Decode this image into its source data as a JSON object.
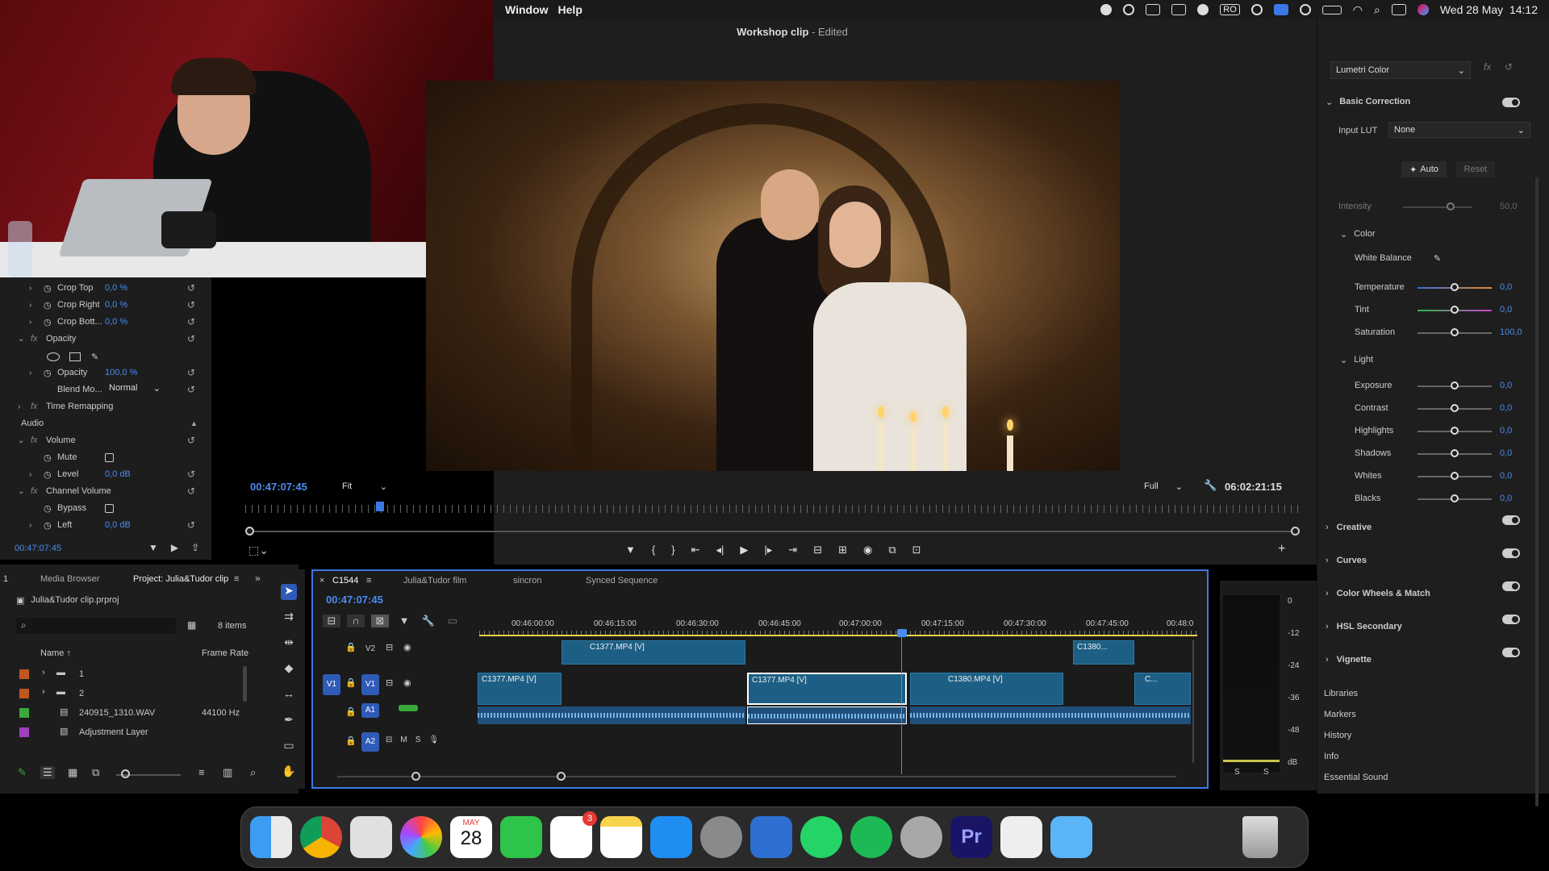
{
  "menubar": {
    "items": [
      "Window",
      "Help"
    ],
    "date_time": "Wed 28 May  14:12",
    "lang": "RO"
  },
  "monitor": {
    "title": "Workshop clip",
    "title_suffix": " - Edited",
    "timecode_left": "00:47:07:45",
    "fit": "Fit",
    "quality": "Full",
    "duration": "06:02:21:15"
  },
  "effects": {
    "rows": [
      {
        "label": "Crop Top",
        "value": "0,0 %"
      },
      {
        "label": "Crop Right",
        "value": "0,0 %"
      },
      {
        "label": "Crop Bott...",
        "value": "0,0 %"
      },
      {
        "label": "Opacity",
        "value": ""
      },
      {
        "label": "Opacity",
        "value": "100,0 %"
      },
      {
        "label": "Blend Mo...",
        "value": "Normal"
      },
      {
        "label": "Time Remapping",
        "value": ""
      },
      {
        "label": "Audio",
        "value": ""
      },
      {
        "label": "Volume",
        "value": ""
      },
      {
        "label": "Mute",
        "value": ""
      },
      {
        "label": "Level",
        "value": "0,0 dB"
      },
      {
        "label": "Channel Volume",
        "value": ""
      },
      {
        "label": "Bypass",
        "value": ""
      },
      {
        "label": "Left",
        "value": "0,0 dB"
      }
    ],
    "timecode": "00:47:07:45"
  },
  "lumetri": {
    "effect": "Lumetri Color",
    "basic": "Basic Correction",
    "input_lut_label": "Input LUT",
    "input_lut_value": "None",
    "auto": "Auto",
    "reset": "Reset",
    "intensity_label": "Intensity",
    "intensity_value": "50,0",
    "color_section": "Color",
    "white_balance": "White Balance",
    "temperature": {
      "label": "Temperature",
      "value": "0,0"
    },
    "tint": {
      "label": "Tint",
      "value": "0,0"
    },
    "saturation": {
      "label": "Saturation",
      "value": "100,0"
    },
    "light_section": "Light",
    "light": [
      {
        "label": "Exposure",
        "value": "0,0"
      },
      {
        "label": "Contrast",
        "value": "0,0"
      },
      {
        "label": "Highlights",
        "value": "0,0"
      },
      {
        "label": "Shadows",
        "value": "0,0"
      },
      {
        "label": "Whites",
        "value": "0,0"
      },
      {
        "label": "Blacks",
        "value": "0,0"
      }
    ],
    "sections": [
      "Creative",
      "Curves",
      "Color Wheels & Match",
      "HSL Secondary",
      "Vignette"
    ],
    "panels": [
      "Libraries",
      "Markers",
      "History",
      "Info",
      "Essential Sound"
    ]
  },
  "project": {
    "tab_num": "1",
    "tabs": [
      "Media Browser",
      "Project: Julia&Tudor clip"
    ],
    "file": "Julia&Tudor clip.prproj",
    "count": "8 items",
    "col_name": "Name",
    "col_rate": "Frame Rate",
    "items": [
      {
        "name": "1",
        "rate": "",
        "color": "#c0571f"
      },
      {
        "name": "2",
        "rate": "",
        "color": "#c0571f"
      },
      {
        "name": "240915_1310.WAV",
        "rate": "44100 Hz",
        "color": "#3aa83a"
      },
      {
        "name": "Adjustment Layer",
        "rate": "",
        "color": "#a040c0"
      }
    ]
  },
  "timeline": {
    "tabs": [
      "C1544",
      "Julia&Tudor film",
      "sincron",
      "Synced Sequence"
    ],
    "timecode": "00:47:07:45",
    "ruler": [
      "00:46:00:00",
      "00:46:15:00",
      "00:46:30:00",
      "00:46:45:00",
      "00:47:00:00",
      "00:47:15:00",
      "00:47:30:00",
      "00:47:45:00",
      "00:48:0"
    ],
    "tracks": [
      "V2",
      "V1",
      "A1",
      "A2"
    ],
    "clips_v2": [
      "C1377.MP4 [V]",
      "C1380..."
    ],
    "clips_v1": [
      "C1377.MP4 [V]",
      "C1377.MP4 [V]",
      "C1380.MP4 [V]",
      "C..."
    ],
    "meter_labels": [
      "0",
      "-12",
      "-24",
      "-36",
      "-48",
      "dB"
    ],
    "meter_s": "S"
  },
  "dock": {
    "badge": "3",
    "calendar_month": "MAY",
    "calendar_day": "28",
    "premiere": "Pr",
    "apps": [
      "finder-icon",
      "chrome-icon",
      "launchpad-icon",
      "photos-icon",
      "calendar-icon",
      "facetime-icon",
      "reminders-icon",
      "notes-icon",
      "appstore-icon",
      "settings-icon",
      "browser-icon",
      "whatsapp-icon",
      "spotify-icon",
      "quicktime-icon",
      "premiere-icon",
      "document-icon",
      "folder-icon",
      "window-icon",
      "window2-icon",
      "trash-icon"
    ]
  }
}
